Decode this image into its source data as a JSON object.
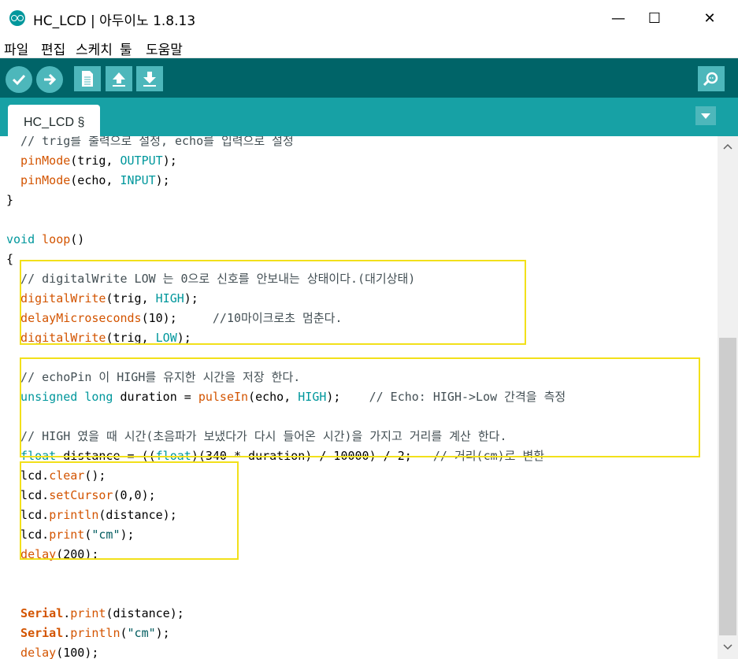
{
  "window": {
    "title": "HC_LCD | 아두이노 1.8.13",
    "minimize_glyph": "—",
    "maximize_glyph": "☐",
    "close_glyph": "✕"
  },
  "menu": [
    "파일",
    "편집",
    "스케치",
    "툴",
    "도움말"
  ],
  "toolbar": {
    "buttons": [
      "verify-icon",
      "upload-icon",
      "new-icon",
      "open-icon",
      "save-icon"
    ],
    "serial_monitor": "serial-monitor-icon",
    "accent": "#006468",
    "button_color": "#4db7bb"
  },
  "tabs": {
    "active": "HC_LCD §"
  },
  "code": {
    "lines": [
      [
        [
          "cm",
          "  // trig를 출력으로 설정, echo를 입력으로 설정"
        ]
      ],
      [
        [
          "fn",
          "  pinMode"
        ],
        [
          "pl",
          "(trig, "
        ],
        [
          "kw",
          "OUTPUT"
        ],
        [
          "pl",
          ");"
        ]
      ],
      [
        [
          "fn",
          "  pinMode"
        ],
        [
          "pl",
          "(echo, "
        ],
        [
          "kw",
          "INPUT"
        ],
        [
          "pl",
          ");"
        ]
      ],
      [
        [
          "pl",
          "}"
        ]
      ],
      [
        [
          "pl",
          ""
        ]
      ],
      [
        [
          "kw",
          "void"
        ],
        [
          "pl",
          " "
        ],
        [
          "fn",
          "loop"
        ],
        [
          "pl",
          "()"
        ]
      ],
      [
        [
          "pl",
          "{"
        ]
      ],
      [
        [
          "cm",
          "  // digitalWrite LOW 는 0으로 신호를 안보내는 상태이다.(대기상태)"
        ]
      ],
      [
        [
          "fn",
          "  digitalWrite"
        ],
        [
          "pl",
          "(trig, "
        ],
        [
          "kw",
          "HIGH"
        ],
        [
          "pl",
          ");"
        ]
      ],
      [
        [
          "fn",
          "  delayMicroseconds"
        ],
        [
          "pl",
          "(10);     "
        ],
        [
          "cm",
          "//10마이크로초 멈춘다."
        ]
      ],
      [
        [
          "fn",
          "  digitalWrite"
        ],
        [
          "pl",
          "(trig, "
        ],
        [
          "kw",
          "LOW"
        ],
        [
          "pl",
          ");"
        ]
      ],
      [
        [
          "pl",
          ""
        ]
      ],
      [
        [
          "cm",
          "  // echoPin 이 HIGH를 유지한 시간을 저장 한다."
        ]
      ],
      [
        [
          "kw",
          "  unsigned"
        ],
        [
          "pl",
          " "
        ],
        [
          "kw",
          "long"
        ],
        [
          "pl",
          " duration = "
        ],
        [
          "fn",
          "pulseIn"
        ],
        [
          "pl",
          "(echo, "
        ],
        [
          "kw",
          "HIGH"
        ],
        [
          "pl",
          ");    "
        ],
        [
          "cm",
          "// Echo: HIGH->Low 간격을 측정"
        ]
      ],
      [
        [
          "pl",
          ""
        ]
      ],
      [
        [
          "cm",
          "  // HIGH 였을 때 시간(초음파가 보냈다가 다시 들어온 시간)을 가지고 거리를 계산 한다."
        ]
      ],
      [
        [
          "kw",
          "  float"
        ],
        [
          "pl",
          " distance = (("
        ],
        [
          "kw",
          "float"
        ],
        [
          "pl",
          ")(340 * duration) / 10000) / 2;   "
        ],
        [
          "cm",
          "// 거리(cm)로 변환"
        ]
      ],
      [
        [
          "pl",
          "  lcd."
        ],
        [
          "fn",
          "clear"
        ],
        [
          "pl",
          "();"
        ]
      ],
      [
        [
          "pl",
          "  lcd."
        ],
        [
          "fn",
          "setCursor"
        ],
        [
          "pl",
          "(0,0);"
        ]
      ],
      [
        [
          "pl",
          "  lcd."
        ],
        [
          "fn",
          "println"
        ],
        [
          "pl",
          "(distance);"
        ]
      ],
      [
        [
          "pl",
          "  lcd."
        ],
        [
          "fn",
          "print"
        ],
        [
          "pl",
          "("
        ],
        [
          "st",
          "\"cm\""
        ],
        [
          "pl",
          ");"
        ]
      ],
      [
        [
          "fn",
          "  delay"
        ],
        [
          "pl",
          "(200);"
        ]
      ],
      [
        [
          "pl",
          ""
        ]
      ],
      [
        [
          "pl",
          ""
        ]
      ],
      [
        [
          "obj",
          "  Serial"
        ],
        [
          "pl",
          "."
        ],
        [
          "fn",
          "print"
        ],
        [
          "pl",
          "(distance);"
        ]
      ],
      [
        [
          "obj",
          "  Serial"
        ],
        [
          "pl",
          "."
        ],
        [
          "fn",
          "println"
        ],
        [
          "pl",
          "("
        ],
        [
          "st",
          "\"cm\""
        ],
        [
          "pl",
          ");"
        ]
      ],
      [
        [
          "fn",
          "  delay"
        ],
        [
          "pl",
          "(100);"
        ]
      ],
      [
        [
          "pl",
          "}"
        ]
      ]
    ]
  },
  "highlight_color": "#f2e01a"
}
